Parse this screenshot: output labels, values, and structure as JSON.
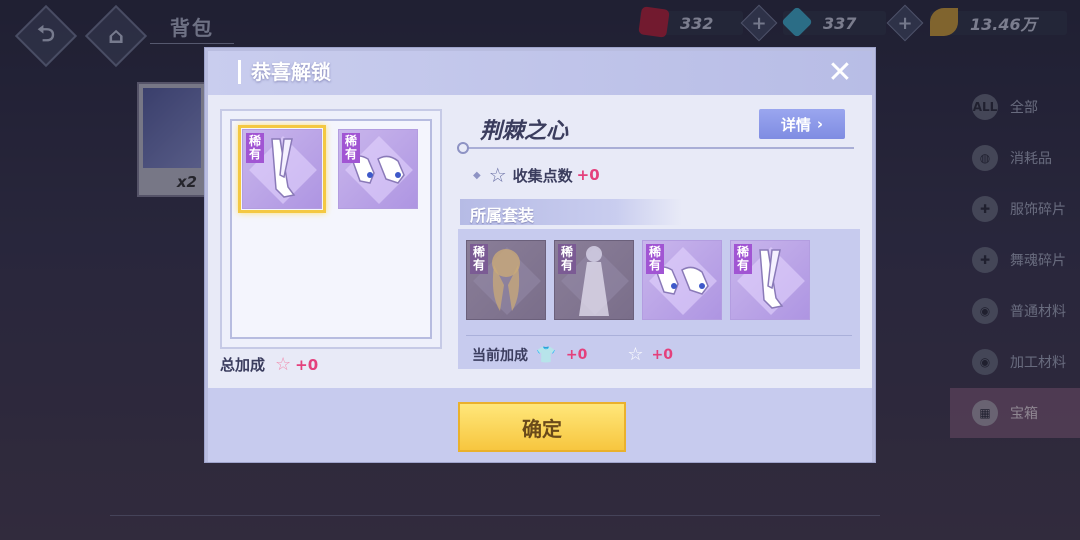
{
  "header": {
    "page_title": "背包",
    "back_icon": "back-arrow-icon",
    "home_icon": "home-icon"
  },
  "currencies": [
    {
      "name": "ruby",
      "icon": "red-gem-icon",
      "value": "332",
      "color": "#c0203a"
    },
    {
      "name": "diamond",
      "icon": "blue-diamond-icon",
      "value": "337",
      "color": "#3fb7d7"
    },
    {
      "name": "gold",
      "icon": "gold-leaf-icon",
      "value": "13.46万",
      "color": "#d9a637"
    }
  ],
  "background_item": {
    "count": "x2"
  },
  "sidebar": {
    "items": [
      {
        "label": "全部",
        "icon": "all-icon",
        "active": false
      },
      {
        "label": "消耗品",
        "icon": "bag-icon",
        "active": false
      },
      {
        "label": "服饰碎片",
        "icon": "puzzle-icon",
        "active": false
      },
      {
        "label": "舞魂碎片",
        "icon": "puzzle-icon",
        "active": false
      },
      {
        "label": "普通材料",
        "icon": "material-icon",
        "active": false
      },
      {
        "label": "加工材料",
        "icon": "material-icon",
        "active": false
      },
      {
        "label": "宝箱",
        "icon": "gift-icon",
        "active": true
      }
    ]
  },
  "modal": {
    "title": "恭喜解锁",
    "close_icon": "close-icon",
    "unlocked_items": [
      {
        "badge": "稀有",
        "kind": "boots",
        "selected": true
      },
      {
        "badge": "稀有",
        "kind": "shoes",
        "selected": false
      }
    ],
    "total_bonus": {
      "label": "总加成",
      "value": "+0"
    },
    "item_name": "荆棘之心",
    "detail_button": "详情",
    "collect": {
      "label": "收集点数",
      "value": "+0"
    },
    "set_section_title": "所属套装",
    "set_items": [
      {
        "badge": "稀有",
        "kind": "hair",
        "owned": false
      },
      {
        "badge": "稀有",
        "kind": "dress",
        "owned": false
      },
      {
        "badge": "稀有",
        "kind": "shoes",
        "owned": true
      },
      {
        "badge": "稀有",
        "kind": "boots",
        "owned": true
      }
    ],
    "current_bonus": {
      "label": "当前加成",
      "shirt_value": "+0",
      "star_value": "+0"
    },
    "confirm_button": "确定"
  }
}
